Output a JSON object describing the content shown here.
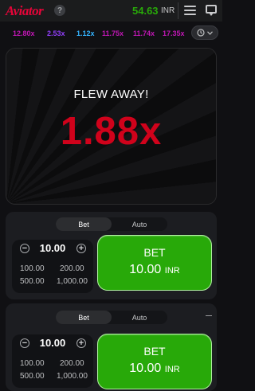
{
  "header": {
    "logo": "Aviator",
    "help": "?",
    "balance": "54.63",
    "currency": "INR"
  },
  "history": {
    "items": [
      {
        "value": "12.80x",
        "color": "#c017b4"
      },
      {
        "value": "2.53x",
        "color": "#913ef8"
      },
      {
        "value": "1.12x",
        "color": "#34b4ff"
      },
      {
        "value": "11.75x",
        "color": "#c017b4"
      },
      {
        "value": "11.74x",
        "color": "#c017b4"
      },
      {
        "value": "17.35x",
        "color": "#c017b4"
      }
    ]
  },
  "game": {
    "status": "FLEW AWAY!",
    "multiplier": "1.88x"
  },
  "panels": [
    {
      "tabs": [
        "Bet",
        "Auto"
      ],
      "active_tab": "Bet",
      "stake": "10.00",
      "minus": "−",
      "plus": "+",
      "quick": [
        "100.00",
        "200.00",
        "500.00",
        "1,000.00"
      ],
      "bet_label": "BET",
      "bet_amount": "10.00",
      "bet_currency": "INR"
    },
    {
      "tabs": [
        "Bet",
        "Auto"
      ],
      "active_tab": "Bet",
      "stake": "10.00",
      "minus": "−",
      "plus": "+",
      "quick": [
        "100.00",
        "200.00",
        "500.00",
        "1,000.00"
      ],
      "bet_label": "BET",
      "bet_amount": "10.00",
      "bet_currency": "INR"
    }
  ],
  "colors": {
    "brand": "#e50539",
    "balance": "#28a909",
    "bet_button": "#28a909",
    "crash": "#d0021b"
  },
  "icons": [
    "help-icon",
    "menu-icon",
    "chat-icon",
    "history-icon",
    "chevron-down-icon",
    "minus-icon",
    "plus-icon"
  ]
}
